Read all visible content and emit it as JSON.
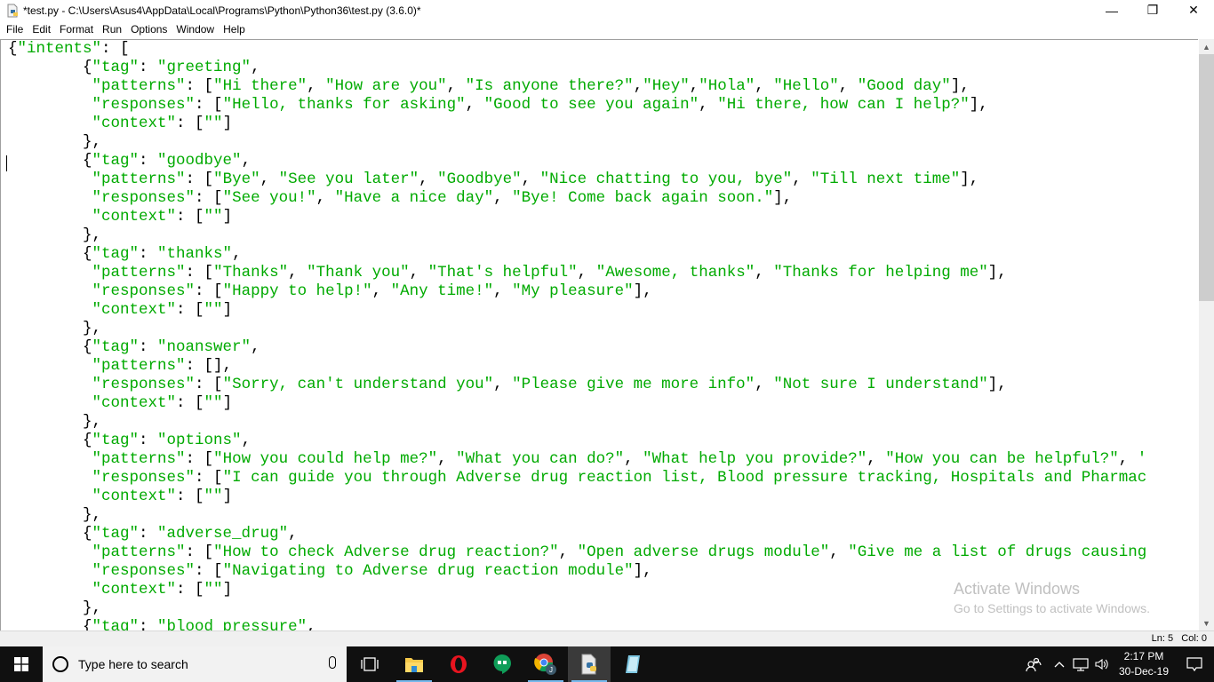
{
  "window": {
    "title": "*test.py - C:\\Users\\Asus4\\AppData\\Local\\Programs\\Python\\Python36\\test.py (3.6.0)*",
    "controls": {
      "minimize": "—",
      "maximize": "❐",
      "close": "✕"
    }
  },
  "menu": {
    "items": [
      "File",
      "Edit",
      "Format",
      "Run",
      "Options",
      "Window",
      "Help"
    ]
  },
  "editor": {
    "lines": [
      [
        {
          "t": "{",
          "c": "p"
        },
        {
          "t": "\"intents\"",
          "c": "s"
        },
        {
          "t": ": [",
          "c": "p"
        }
      ],
      [
        {
          "t": "        {",
          "c": "p"
        },
        {
          "t": "\"tag\"",
          "c": "s"
        },
        {
          "t": ": ",
          "c": "p"
        },
        {
          "t": "\"greeting\"",
          "c": "s"
        },
        {
          "t": ",",
          "c": "p"
        }
      ],
      [
        {
          "t": "         ",
          "c": "p"
        },
        {
          "t": "\"patterns\"",
          "c": "s"
        },
        {
          "t": ": [",
          "c": "p"
        },
        {
          "t": "\"Hi there\"",
          "c": "s"
        },
        {
          "t": ", ",
          "c": "p"
        },
        {
          "t": "\"How are you\"",
          "c": "s"
        },
        {
          "t": ", ",
          "c": "p"
        },
        {
          "t": "\"Is anyone there?\"",
          "c": "s"
        },
        {
          "t": ",",
          "c": "p"
        },
        {
          "t": "\"Hey\"",
          "c": "s"
        },
        {
          "t": ",",
          "c": "p"
        },
        {
          "t": "\"Hola\"",
          "c": "s"
        },
        {
          "t": ", ",
          "c": "p"
        },
        {
          "t": "\"Hello\"",
          "c": "s"
        },
        {
          "t": ", ",
          "c": "p"
        },
        {
          "t": "\"Good day\"",
          "c": "s"
        },
        {
          "t": "],",
          "c": "p"
        }
      ],
      [
        {
          "t": "         ",
          "c": "p"
        },
        {
          "t": "\"responses\"",
          "c": "s"
        },
        {
          "t": ": [",
          "c": "p"
        },
        {
          "t": "\"Hello, thanks for asking\"",
          "c": "s"
        },
        {
          "t": ", ",
          "c": "p"
        },
        {
          "t": "\"Good to see you again\"",
          "c": "s"
        },
        {
          "t": ", ",
          "c": "p"
        },
        {
          "t": "\"Hi there, how can I help?\"",
          "c": "s"
        },
        {
          "t": "],",
          "c": "p"
        }
      ],
      [
        {
          "t": "         ",
          "c": "p"
        },
        {
          "t": "\"context\"",
          "c": "s"
        },
        {
          "t": ": [",
          "c": "p"
        },
        {
          "t": "\"\"",
          "c": "s"
        },
        {
          "t": "]",
          "c": "p"
        }
      ],
      [
        {
          "t": "        },",
          "c": "p"
        }
      ],
      [
        {
          "t": "        {",
          "c": "p"
        },
        {
          "t": "\"tag\"",
          "c": "s"
        },
        {
          "t": ": ",
          "c": "p"
        },
        {
          "t": "\"goodbye\"",
          "c": "s"
        },
        {
          "t": ",",
          "c": "p"
        }
      ],
      [
        {
          "t": "         ",
          "c": "p"
        },
        {
          "t": "\"patterns\"",
          "c": "s"
        },
        {
          "t": ": [",
          "c": "p"
        },
        {
          "t": "\"Bye\"",
          "c": "s"
        },
        {
          "t": ", ",
          "c": "p"
        },
        {
          "t": "\"See you later\"",
          "c": "s"
        },
        {
          "t": ", ",
          "c": "p"
        },
        {
          "t": "\"Goodbye\"",
          "c": "s"
        },
        {
          "t": ", ",
          "c": "p"
        },
        {
          "t": "\"Nice chatting to you, bye\"",
          "c": "s"
        },
        {
          "t": ", ",
          "c": "p"
        },
        {
          "t": "\"Till next time\"",
          "c": "s"
        },
        {
          "t": "],",
          "c": "p"
        }
      ],
      [
        {
          "t": "         ",
          "c": "p"
        },
        {
          "t": "\"responses\"",
          "c": "s"
        },
        {
          "t": ": [",
          "c": "p"
        },
        {
          "t": "\"See you!\"",
          "c": "s"
        },
        {
          "t": ", ",
          "c": "p"
        },
        {
          "t": "\"Have a nice day\"",
          "c": "s"
        },
        {
          "t": ", ",
          "c": "p"
        },
        {
          "t": "\"Bye! Come back again soon.\"",
          "c": "s"
        },
        {
          "t": "],",
          "c": "p"
        }
      ],
      [
        {
          "t": "         ",
          "c": "p"
        },
        {
          "t": "\"context\"",
          "c": "s"
        },
        {
          "t": ": [",
          "c": "p"
        },
        {
          "t": "\"\"",
          "c": "s"
        },
        {
          "t": "]",
          "c": "p"
        }
      ],
      [
        {
          "t": "        },",
          "c": "p"
        }
      ],
      [
        {
          "t": "        {",
          "c": "p"
        },
        {
          "t": "\"tag\"",
          "c": "s"
        },
        {
          "t": ": ",
          "c": "p"
        },
        {
          "t": "\"thanks\"",
          "c": "s"
        },
        {
          "t": ",",
          "c": "p"
        }
      ],
      [
        {
          "t": "         ",
          "c": "p"
        },
        {
          "t": "\"patterns\"",
          "c": "s"
        },
        {
          "t": ": [",
          "c": "p"
        },
        {
          "t": "\"Thanks\"",
          "c": "s"
        },
        {
          "t": ", ",
          "c": "p"
        },
        {
          "t": "\"Thank you\"",
          "c": "s"
        },
        {
          "t": ", ",
          "c": "p"
        },
        {
          "t": "\"That's helpful\"",
          "c": "s"
        },
        {
          "t": ", ",
          "c": "p"
        },
        {
          "t": "\"Awesome, thanks\"",
          "c": "s"
        },
        {
          "t": ", ",
          "c": "p"
        },
        {
          "t": "\"Thanks for helping me\"",
          "c": "s"
        },
        {
          "t": "],",
          "c": "p"
        }
      ],
      [
        {
          "t": "         ",
          "c": "p"
        },
        {
          "t": "\"responses\"",
          "c": "s"
        },
        {
          "t": ": [",
          "c": "p"
        },
        {
          "t": "\"Happy to help!\"",
          "c": "s"
        },
        {
          "t": ", ",
          "c": "p"
        },
        {
          "t": "\"Any time!\"",
          "c": "s"
        },
        {
          "t": ", ",
          "c": "p"
        },
        {
          "t": "\"My pleasure\"",
          "c": "s"
        },
        {
          "t": "],",
          "c": "p"
        }
      ],
      [
        {
          "t": "         ",
          "c": "p"
        },
        {
          "t": "\"context\"",
          "c": "s"
        },
        {
          "t": ": [",
          "c": "p"
        },
        {
          "t": "\"\"",
          "c": "s"
        },
        {
          "t": "]",
          "c": "p"
        }
      ],
      [
        {
          "t": "        },",
          "c": "p"
        }
      ],
      [
        {
          "t": "        {",
          "c": "p"
        },
        {
          "t": "\"tag\"",
          "c": "s"
        },
        {
          "t": ": ",
          "c": "p"
        },
        {
          "t": "\"noanswer\"",
          "c": "s"
        },
        {
          "t": ",",
          "c": "p"
        }
      ],
      [
        {
          "t": "         ",
          "c": "p"
        },
        {
          "t": "\"patterns\"",
          "c": "s"
        },
        {
          "t": ": [],",
          "c": "p"
        }
      ],
      [
        {
          "t": "         ",
          "c": "p"
        },
        {
          "t": "\"responses\"",
          "c": "s"
        },
        {
          "t": ": [",
          "c": "p"
        },
        {
          "t": "\"Sorry, can't understand you\"",
          "c": "s"
        },
        {
          "t": ", ",
          "c": "p"
        },
        {
          "t": "\"Please give me more info\"",
          "c": "s"
        },
        {
          "t": ", ",
          "c": "p"
        },
        {
          "t": "\"Not sure I understand\"",
          "c": "s"
        },
        {
          "t": "],",
          "c": "p"
        }
      ],
      [
        {
          "t": "         ",
          "c": "p"
        },
        {
          "t": "\"context\"",
          "c": "s"
        },
        {
          "t": ": [",
          "c": "p"
        },
        {
          "t": "\"\"",
          "c": "s"
        },
        {
          "t": "]",
          "c": "p"
        }
      ],
      [
        {
          "t": "        },",
          "c": "p"
        }
      ],
      [
        {
          "t": "        {",
          "c": "p"
        },
        {
          "t": "\"tag\"",
          "c": "s"
        },
        {
          "t": ": ",
          "c": "p"
        },
        {
          "t": "\"options\"",
          "c": "s"
        },
        {
          "t": ",",
          "c": "p"
        }
      ],
      [
        {
          "t": "         ",
          "c": "p"
        },
        {
          "t": "\"patterns\"",
          "c": "s"
        },
        {
          "t": ": [",
          "c": "p"
        },
        {
          "t": "\"How you could help me?\"",
          "c": "s"
        },
        {
          "t": ", ",
          "c": "p"
        },
        {
          "t": "\"What you can do?\"",
          "c": "s"
        },
        {
          "t": ", ",
          "c": "p"
        },
        {
          "t": "\"What help you provide?\"",
          "c": "s"
        },
        {
          "t": ", ",
          "c": "p"
        },
        {
          "t": "\"How you can be helpful?\"",
          "c": "s"
        },
        {
          "t": ", ",
          "c": "p"
        },
        {
          "t": "'",
          "c": "s"
        }
      ],
      [
        {
          "t": "         ",
          "c": "p"
        },
        {
          "t": "\"responses\"",
          "c": "s"
        },
        {
          "t": ": [",
          "c": "p"
        },
        {
          "t": "\"I can guide you through Adverse drug reaction list, Blood pressure tracking, Hospitals and Pharmac",
          "c": "s"
        }
      ],
      [
        {
          "t": "         ",
          "c": "p"
        },
        {
          "t": "\"context\"",
          "c": "s"
        },
        {
          "t": ": [",
          "c": "p"
        },
        {
          "t": "\"\"",
          "c": "s"
        },
        {
          "t": "]",
          "c": "p"
        }
      ],
      [
        {
          "t": "        },",
          "c": "p"
        }
      ],
      [
        {
          "t": "        {",
          "c": "p"
        },
        {
          "t": "\"tag\"",
          "c": "s"
        },
        {
          "t": ": ",
          "c": "p"
        },
        {
          "t": "\"adverse_drug\"",
          "c": "s"
        },
        {
          "t": ",",
          "c": "p"
        }
      ],
      [
        {
          "t": "         ",
          "c": "p"
        },
        {
          "t": "\"patterns\"",
          "c": "s"
        },
        {
          "t": ": [",
          "c": "p"
        },
        {
          "t": "\"How to check Adverse drug reaction?\"",
          "c": "s"
        },
        {
          "t": ", ",
          "c": "p"
        },
        {
          "t": "\"Open adverse drugs module\"",
          "c": "s"
        },
        {
          "t": ", ",
          "c": "p"
        },
        {
          "t": "\"Give me a list of drugs causing",
          "c": "s"
        }
      ],
      [
        {
          "t": "         ",
          "c": "p"
        },
        {
          "t": "\"responses\"",
          "c": "s"
        },
        {
          "t": ": [",
          "c": "p"
        },
        {
          "t": "\"Navigating to Adverse drug reaction module\"",
          "c": "s"
        },
        {
          "t": "],",
          "c": "p"
        }
      ],
      [
        {
          "t": "         ",
          "c": "p"
        },
        {
          "t": "\"context\"",
          "c": "s"
        },
        {
          "t": ": [",
          "c": "p"
        },
        {
          "t": "\"\"",
          "c": "s"
        },
        {
          "t": "]",
          "c": "p"
        }
      ],
      [
        {
          "t": "        },",
          "c": "p"
        }
      ],
      [
        {
          "t": "        {",
          "c": "p"
        },
        {
          "t": "\"tag\"",
          "c": "s"
        },
        {
          "t": ": ",
          "c": "p"
        },
        {
          "t": "\"blood_pressure\"",
          "c": "s"
        },
        {
          "t": ",",
          "c": "p"
        }
      ]
    ],
    "colors": {
      "string": "#00aa00",
      "plain": "#000000"
    }
  },
  "watermark": {
    "line1": "Activate Windows",
    "line2": "Go to Settings to activate Windows."
  },
  "status": {
    "text": "Ln: 5   Col: 0"
  },
  "taskbar": {
    "search_placeholder": "Type here to search",
    "apps": [
      "task-view",
      "file-explorer",
      "opera",
      "hangouts",
      "chrome",
      "python-idle",
      "notepad"
    ],
    "clock_time": "2:17 PM",
    "clock_date": "30-Dec-19"
  }
}
